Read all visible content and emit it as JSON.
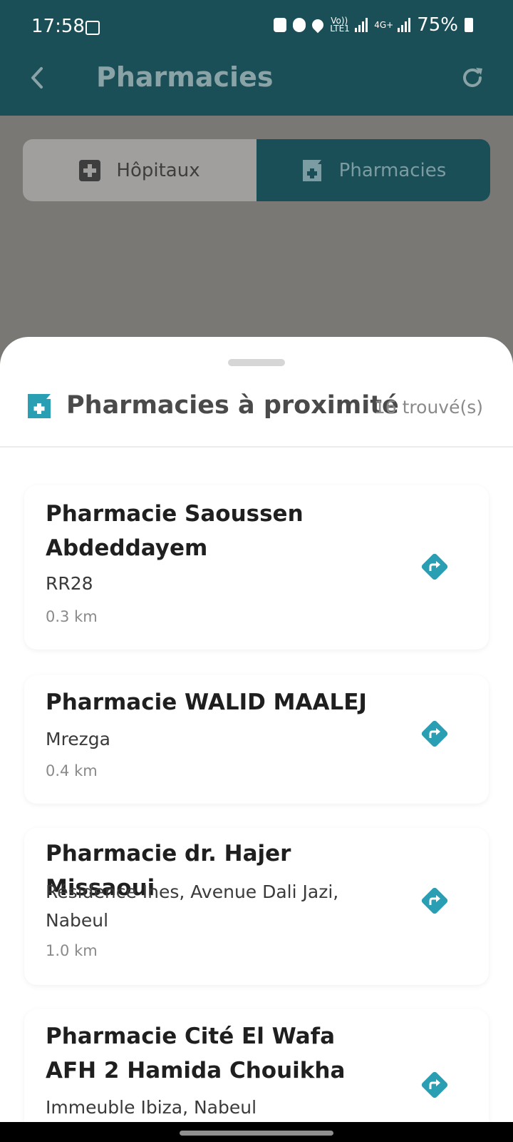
{
  "status_bar": {
    "time": "17:58",
    "volte_label": "Vo)) LTE1",
    "net_label": "4G+",
    "battery": "75%"
  },
  "app_bar": {
    "title": "Pharmacies",
    "back_icon": "arrow-back-icon",
    "refresh_icon": "refresh-icon"
  },
  "segments": [
    {
      "label": "Hôpitaux",
      "icon": "hospital-plus-icon",
      "selected": false
    },
    {
      "label": "Pharmacies",
      "icon": "pharmacy-icon",
      "selected": true
    }
  ],
  "sheet": {
    "title": "Pharmacies à proximité",
    "count": "16 trouvé(s)",
    "accent": "#2a9fb3"
  },
  "pharmacies": [
    {
      "name": "Pharmacie Saoussen Abdeddayem",
      "address": "RR28",
      "distance": "0.3 km"
    },
    {
      "name": "Pharmacie WALID MAALEJ",
      "address": "Mrezga",
      "distance": "0.4 km"
    },
    {
      "name": "Pharmacie dr. Hajer Missaoui",
      "address": "Résidence Ines, Avenue Dali Jazi, Nabeul",
      "distance": "1.0 km"
    },
    {
      "name": "Pharmacie Cité El Wafa AFH 2 Hamida Chouikha",
      "address": "Immeuble Ibiza, Nabeul",
      "distance": ""
    }
  ]
}
